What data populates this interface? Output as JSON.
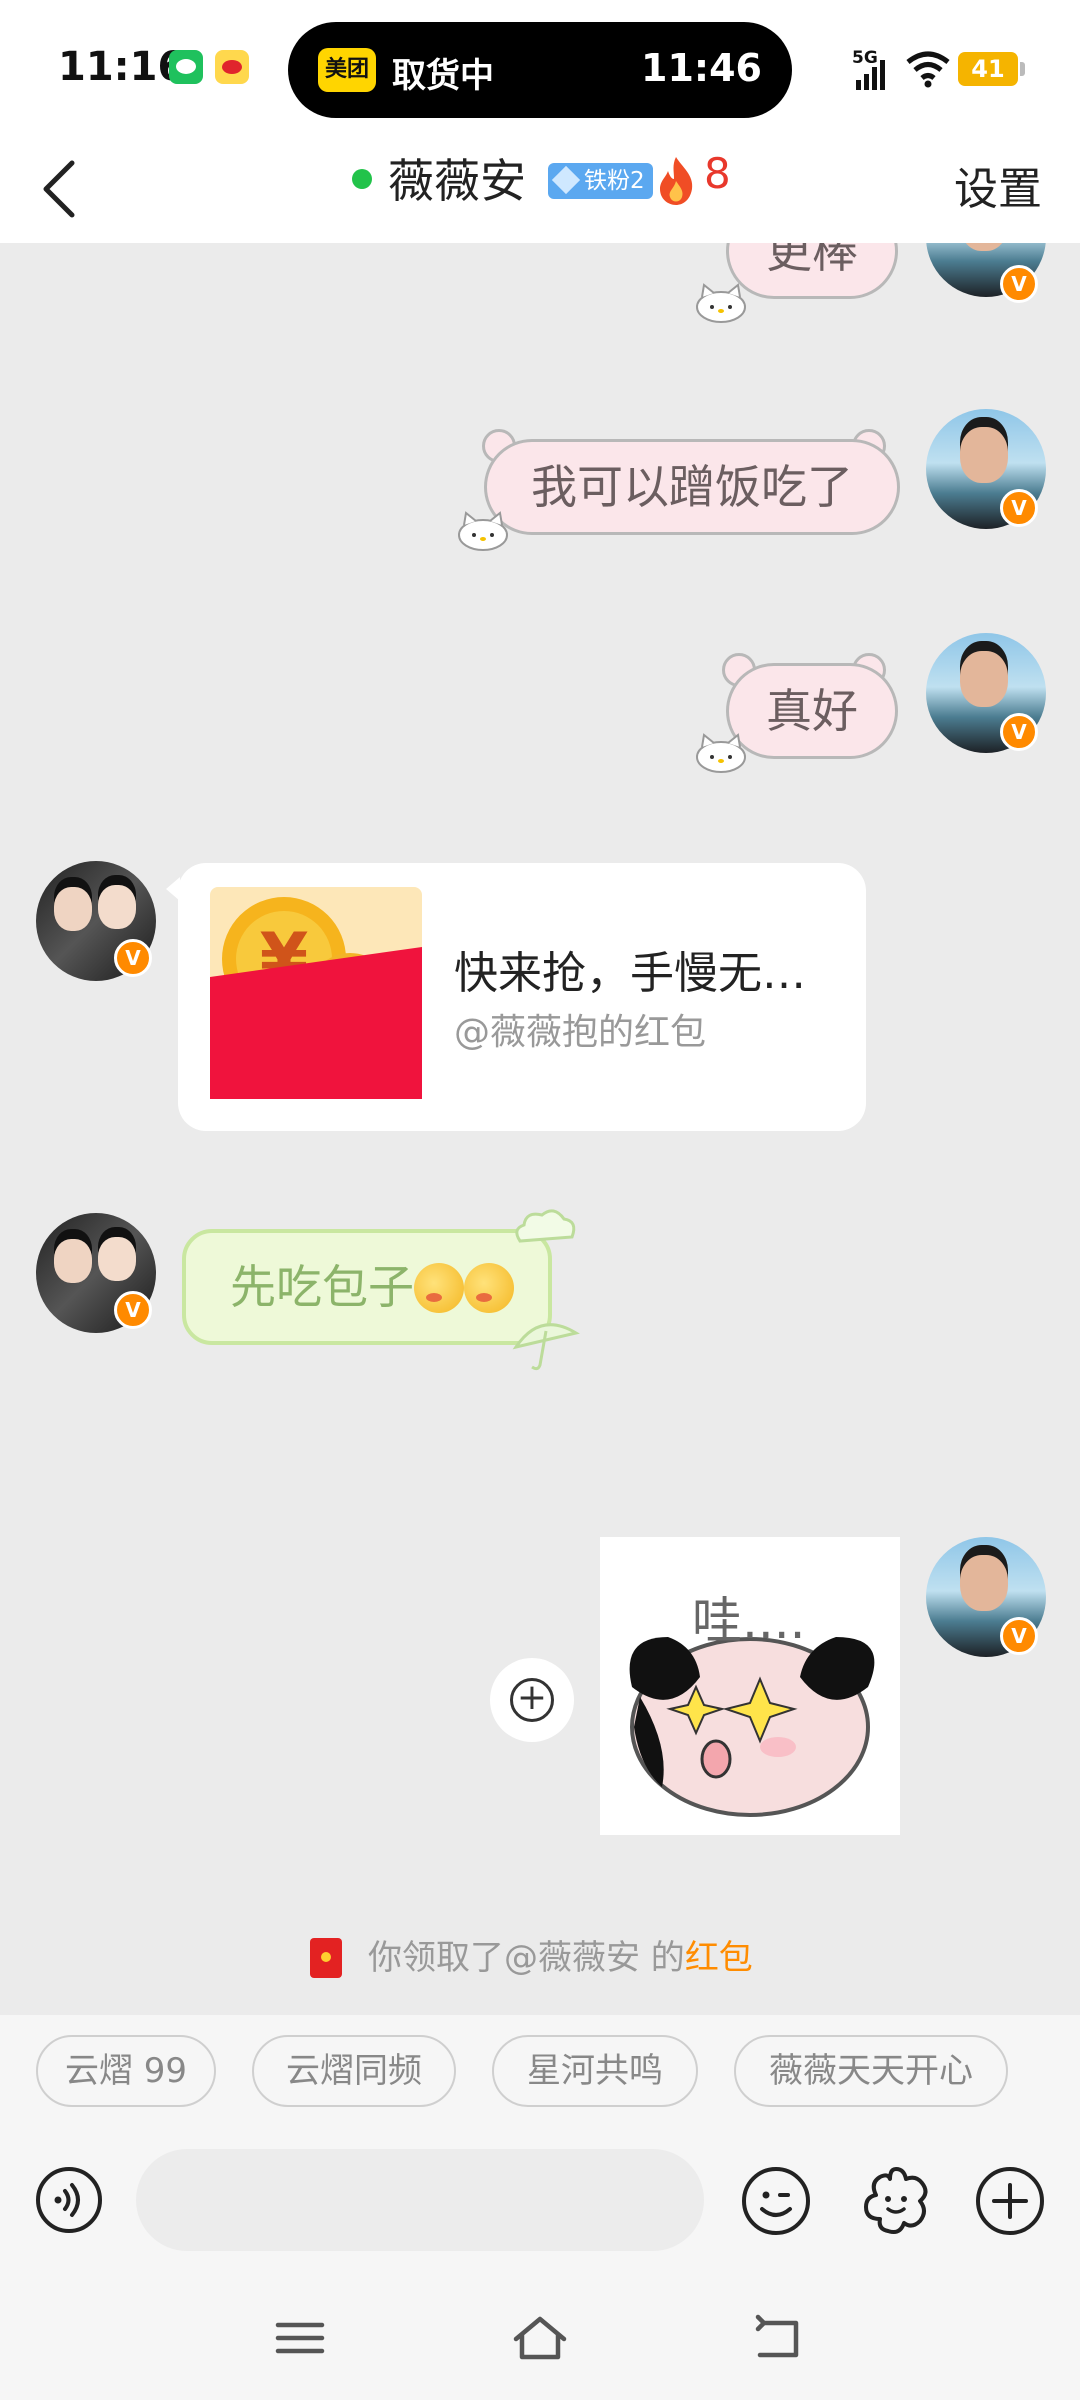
{
  "status_bar": {
    "time": "11:16",
    "island_app_label": "美团",
    "island_status": "取货中",
    "island_time": "11:46",
    "network": "5G",
    "battery": "41"
  },
  "header": {
    "contact_name": "薇薇安",
    "fan_badge": "铁粉2",
    "fire_count": "8",
    "settings": "设置"
  },
  "messages": {
    "sent_1": "更棒",
    "sent_2": "我可以蹭饭吃了",
    "sent_3": "真好",
    "red_packet_title": "快来抢，手慢无…",
    "red_packet_sender": "@薇薇抱的红包",
    "received_text": "先吃包子",
    "sticker_text": "哇...."
  },
  "system_notice": {
    "prefix": "你领取了@薇薇安 的",
    "link": "红包"
  },
  "quick_replies": [
    "云熠 99",
    "云熠同频",
    "星河共鸣",
    "薇薇天天开心"
  ],
  "input": {
    "placeholder": ""
  },
  "colors": {
    "accent_orange": "#ff8c00",
    "online_green": "#22c34a",
    "fire_red": "#e8382c",
    "red_packet_red": "#f0133d"
  },
  "icons": [
    "back-icon",
    "fire-icon",
    "voice-icon",
    "smile-icon",
    "sticker-icon",
    "plus-icon",
    "menu-icon",
    "home-icon",
    "return-icon"
  ]
}
